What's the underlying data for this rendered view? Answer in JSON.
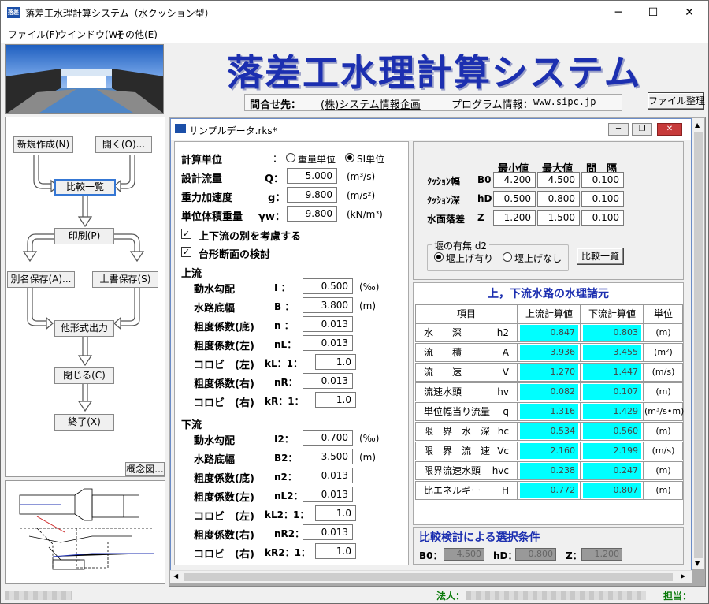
{
  "window": {
    "title": "落差工水理計算システム（水クッション型）",
    "app_icon_text": "落差工"
  },
  "menu": [
    "ファイル(F)",
    "ウインドウ(W)",
    "その他(E)"
  ],
  "banner": {
    "title": "落差工水理計算システム",
    "contact_label": "問合せ先：",
    "contact_value": "(株)システム情報企画",
    "program_label": "プログラム情報：",
    "program_value": "www.sipc.jp",
    "file_btn": "ファイル整理"
  },
  "flow": {
    "new": "新規作成(N)",
    "open": "開く(O)...",
    "compare": "比較一覧",
    "print": "印刷(P)",
    "save_as": "別名保存(A)...",
    "overwrite": "上書保存(S)",
    "export": "他形式出力",
    "close": "閉じる(C)",
    "exit": "終了(X)",
    "concept": "概念図..."
  },
  "child": {
    "title": "サンプルデータ.rks*"
  },
  "form": {
    "unit_label": "計算単位",
    "unit_colon": "：",
    "unit_opt1": "重量単位",
    "unit_opt2": "SI単位",
    "flow_label": "設計流量",
    "flow_sym": "Q：",
    "flow_val": "5.000",
    "flow_unit": "(m³/s)",
    "grav_label": "重力加速度",
    "grav_sym": "g：",
    "grav_val": "9.800",
    "grav_unit": "(m/s²)",
    "weight_label": "単位体積重量",
    "weight_sym": "γw：",
    "weight_val": "9.800",
    "weight_unit": "(kN/m³)",
    "chk1": "上下流の別を考慮する",
    "chk2": "台形断面の検討",
    "upstream": "上流",
    "downstream": "下流",
    "up": [
      {
        "label": "動水勾配",
        "sym": "I ：",
        "val": "0.500",
        "unit": "(‰)"
      },
      {
        "label": "水路底幅",
        "sym": "B ：",
        "val": "3.800",
        "unit": "(m)"
      },
      {
        "label": "粗度係数(底)",
        "sym": "n ：",
        "val": "0.013",
        "unit": ""
      },
      {
        "label": "粗度係数(左)",
        "sym": "nL：",
        "val": "0.013",
        "unit": ""
      },
      {
        "label": "コロビ　(左)",
        "sym": "kL：1：",
        "val": "1.0",
        "unit": ""
      },
      {
        "label": "粗度係数(右)",
        "sym": "nR：",
        "val": "0.013",
        "unit": ""
      },
      {
        "label": "コロビ　(右)",
        "sym": "kR：1：",
        "val": "1.0",
        "unit": ""
      }
    ],
    "down": [
      {
        "label": "動水勾配",
        "sym": "I2：",
        "val": "0.700",
        "unit": "(‰)"
      },
      {
        "label": "水路底幅",
        "sym": "B2：",
        "val": "3.500",
        "unit": "(m)"
      },
      {
        "label": "粗度係数(底)",
        "sym": "n2：",
        "val": "0.013",
        "unit": ""
      },
      {
        "label": "粗度係数(左)",
        "sym": "nL2：",
        "val": "0.013",
        "unit": ""
      },
      {
        "label": "コロビ　(左)",
        "sym": "kL2：1：",
        "val": "1.0",
        "unit": ""
      },
      {
        "label": "粗度係数(右)",
        "sym": "nR2：",
        "val": "0.013",
        "unit": ""
      },
      {
        "label": "コロビ　(右)",
        "sym": "kR2：1：",
        "val": "1.0",
        "unit": ""
      }
    ]
  },
  "range": {
    "headers": [
      "最小値",
      "最大値",
      "間　隔"
    ],
    "rows": [
      {
        "label": "ｸｯｼｮﾝ幅",
        "sym": "B0",
        "min": "4.200",
        "max": "4.500",
        "step": "0.100"
      },
      {
        "label": "ｸｯｼｮﾝ深",
        "sym": "hD",
        "min": "0.500",
        "max": "0.800",
        "step": "0.100"
      },
      {
        "label": "水面落差",
        "sym": "Z",
        "min": "1.200",
        "max": "1.500",
        "step": "0.100"
      }
    ],
    "weir_title": "堰の有無 d2",
    "weir_opt1": "堰上げ有り",
    "weir_opt2": "堰上げなし",
    "compare_btn": "比較一覧"
  },
  "results": {
    "title": "上，下流水路の水理諸元",
    "headers": [
      "項目",
      "上流計算値",
      "下流計算値",
      "単位"
    ],
    "rows": [
      {
        "item": "水　　深",
        "sym": "h2",
        "up": "0.847",
        "down": "0.803",
        "unit": "(m)"
      },
      {
        "item": "流　　積",
        "sym": "A",
        "up": "3.936",
        "down": "3.455",
        "unit": "(m²)"
      },
      {
        "item": "流　　速",
        "sym": "V",
        "up": "1.270",
        "down": "1.447",
        "unit": "(m/s)"
      },
      {
        "item": "流速水頭",
        "sym": "hv",
        "up": "0.082",
        "down": "0.107",
        "unit": "(m)"
      },
      {
        "item": "単位幅当り流量",
        "sym": "q",
        "up": "1.316",
        "down": "1.429",
        "unit": "(m³/s•m)"
      },
      {
        "item": "限　界　水　深",
        "sym": "hc",
        "up": "0.534",
        "down": "0.560",
        "unit": "(m)"
      },
      {
        "item": "限　界　流　速",
        "sym": "Vc",
        "up": "2.160",
        "down": "2.199",
        "unit": "(m/s)"
      },
      {
        "item": "限界流速水頭",
        "sym": "hvc",
        "up": "0.238",
        "down": "0.247",
        "unit": "(m)"
      },
      {
        "item": "比エネルギー",
        "sym": "H",
        "up": "0.772",
        "down": "0.807",
        "unit": "(m)"
      }
    ]
  },
  "selection": {
    "title": "比較検討による選択条件",
    "b0_label": "B0：",
    "b0_val": "4.500",
    "hd_label": "hD：",
    "hd_val": "0.800",
    "z_label": "Z：",
    "z_val": "1.200"
  },
  "status": {
    "corp_label": "法人：",
    "person_label": "担当："
  }
}
